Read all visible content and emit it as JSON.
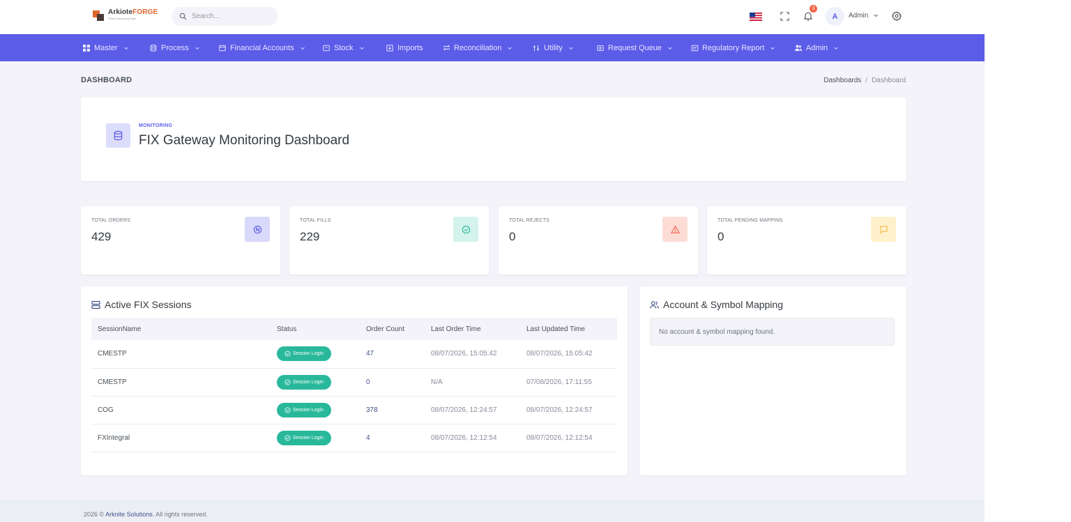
{
  "header": {
    "logo": {
      "name_part1": "Arkiote",
      "name_part2": "FORGE",
      "tagline": "Trade Monitoring Suite"
    },
    "search": {
      "placeholder": "Search..."
    },
    "notifications_count": "3",
    "user": {
      "initial": "A",
      "name": "Admin"
    }
  },
  "nav": {
    "items": [
      {
        "label": "Master",
        "icon": "grid-icon",
        "dropdown": true
      },
      {
        "label": "Process",
        "icon": "database-icon",
        "dropdown": true
      },
      {
        "label": "Financial Accounts",
        "icon": "ledger-icon",
        "dropdown": true
      },
      {
        "label": "Stock",
        "icon": "box-icon",
        "dropdown": true
      },
      {
        "label": "Imports",
        "icon": "import-icon",
        "dropdown": false
      },
      {
        "label": "Reconciliation",
        "icon": "swap-icon",
        "dropdown": true
      },
      {
        "label": "Utility",
        "icon": "tools-icon",
        "dropdown": true
      },
      {
        "label": "Request Queue",
        "icon": "queue-icon",
        "dropdown": true
      },
      {
        "label": "Regulatory Report",
        "icon": "report-icon",
        "dropdown": true
      },
      {
        "label": "Admin",
        "icon": "users-icon",
        "dropdown": true
      }
    ]
  },
  "page": {
    "title": "DASHBOARD",
    "breadcrumb": {
      "parent": "Dashboards",
      "current": "Dashboard"
    }
  },
  "hero": {
    "eyebrow": "MONITORING",
    "title": "FIX Gateway Monitoring Dashboard"
  },
  "stats": [
    {
      "label": "TOTAL ORDERS",
      "value": "429",
      "icon": "order-icon",
      "bg": "#d9d9fb",
      "fg": "#5b5ce8"
    },
    {
      "label": "TOTAL FILLS",
      "value": "229",
      "icon": "check-circle-icon",
      "bg": "#d4f3ec",
      "fg": "#29b89a"
    },
    {
      "label": "TOTAL REJECTS",
      "value": "0",
      "icon": "warning-icon",
      "bg": "#fddcd6",
      "fg": "#f06548"
    },
    {
      "label": "TOTAL PENDING MAPPING",
      "value": "0",
      "icon": "message-icon",
      "bg": "#fef1cc",
      "fg": "#f7b84b"
    }
  ],
  "sessions": {
    "title": "Active FIX Sessions",
    "columns": [
      "SessionName",
      "Status",
      "Order Count",
      "Last Order Time",
      "Last Updated Time"
    ],
    "rows": [
      {
        "name": "CMESTP",
        "status": "Session Login",
        "count": "47",
        "last_order": "08/07/2026, 15:05:42",
        "last_updated": "08/07/2026, 15:05:42"
      },
      {
        "name": "CMESTP",
        "status": "Session Login",
        "count": "0",
        "last_order": "N/A",
        "last_updated": "07/08/2026, 17:11:55"
      },
      {
        "name": "COG",
        "status": "Session Login",
        "count": "378",
        "last_order": "08/07/2026, 12:24:57",
        "last_updated": "08/07/2026, 12:24:57"
      },
      {
        "name": "FXIntegral",
        "status": "Session Login",
        "count": "4",
        "last_order": "08/07/2026, 12:12:54",
        "last_updated": "08/07/2026, 12:12:54"
      }
    ]
  },
  "mapping": {
    "title": "Account & Symbol Mapping",
    "empty_text": "No account & symbol mapping found."
  },
  "footer": {
    "year": "2026 ©",
    "brand": "Arknite Solutions.",
    "rights": "All rights reserved."
  }
}
